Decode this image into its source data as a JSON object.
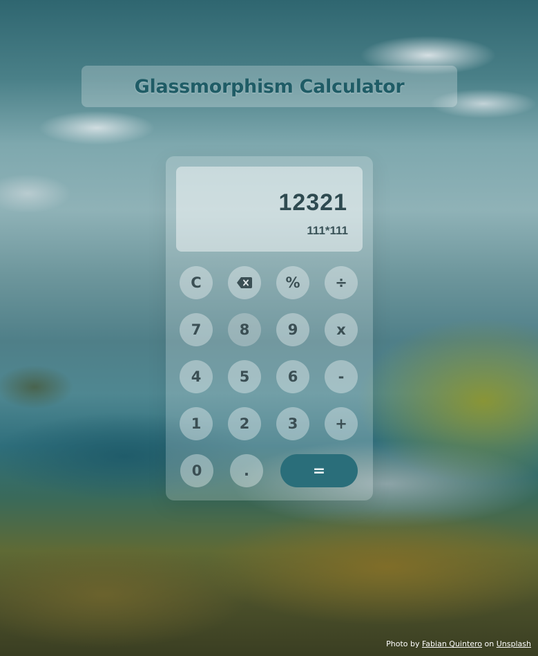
{
  "header": {
    "title": "Glassmorphism Calculator"
  },
  "display": {
    "result": "12321",
    "expression": "111*111"
  },
  "keys": {
    "clear": "C",
    "backspace_icon": "backspace-icon",
    "percent": "%",
    "divide": "÷",
    "seven": "7",
    "eight": "8",
    "nine": "9",
    "multiply": "x",
    "four": "4",
    "five": "5",
    "six": "6",
    "minus": "-",
    "one": "1",
    "two": "2",
    "three": "3",
    "plus": "+",
    "zero": "0",
    "decimal": ".",
    "equals": "="
  },
  "footer": {
    "prefix": "Photo by",
    "author": "Fabian Quintero",
    "middle": "on",
    "source": "Unsplash"
  },
  "colors": {
    "title": "#1f5c66",
    "equals_button": "#2a6e7a",
    "text": "#3b4f54"
  }
}
